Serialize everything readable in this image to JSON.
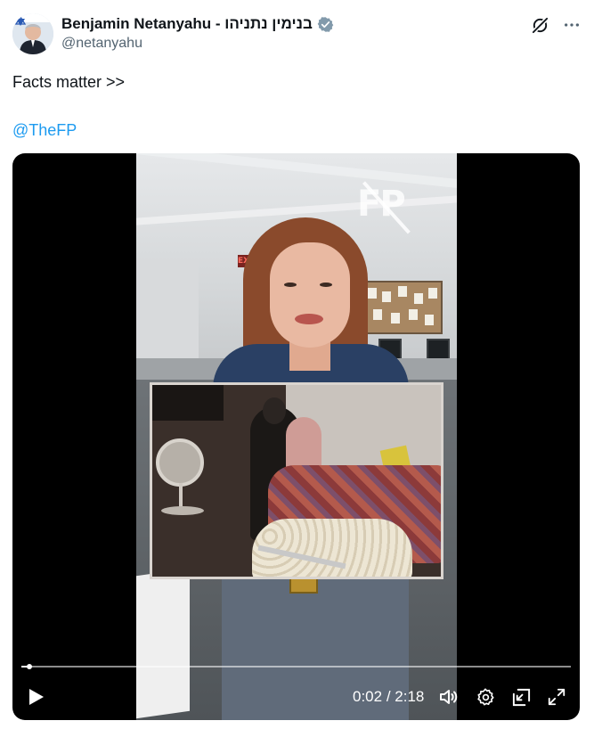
{
  "author": {
    "display_name": "Benjamin Netanyahu - בנימין נתניהו",
    "handle": "@netanyahu",
    "verified": true,
    "verified_color": "#829aab"
  },
  "post": {
    "text": "Facts matter >>",
    "mention": "@TheFP",
    "mention_color": "#1d9bf0"
  },
  "video": {
    "watermark": "FP",
    "exit_sign": "EXIT",
    "time_current": "0:02",
    "time_separator": "/",
    "time_total": "2:18",
    "time_display": "0:02 / 2:18",
    "progress_fraction": 0.0145,
    "icons": {
      "play": "play-icon",
      "volume": "volume-icon",
      "settings": "gear-icon",
      "dock": "dock-icon",
      "fullscreen": "fullscreen-icon"
    }
  },
  "top_actions": {
    "grok": "grok-icon",
    "more": "more-icon"
  }
}
